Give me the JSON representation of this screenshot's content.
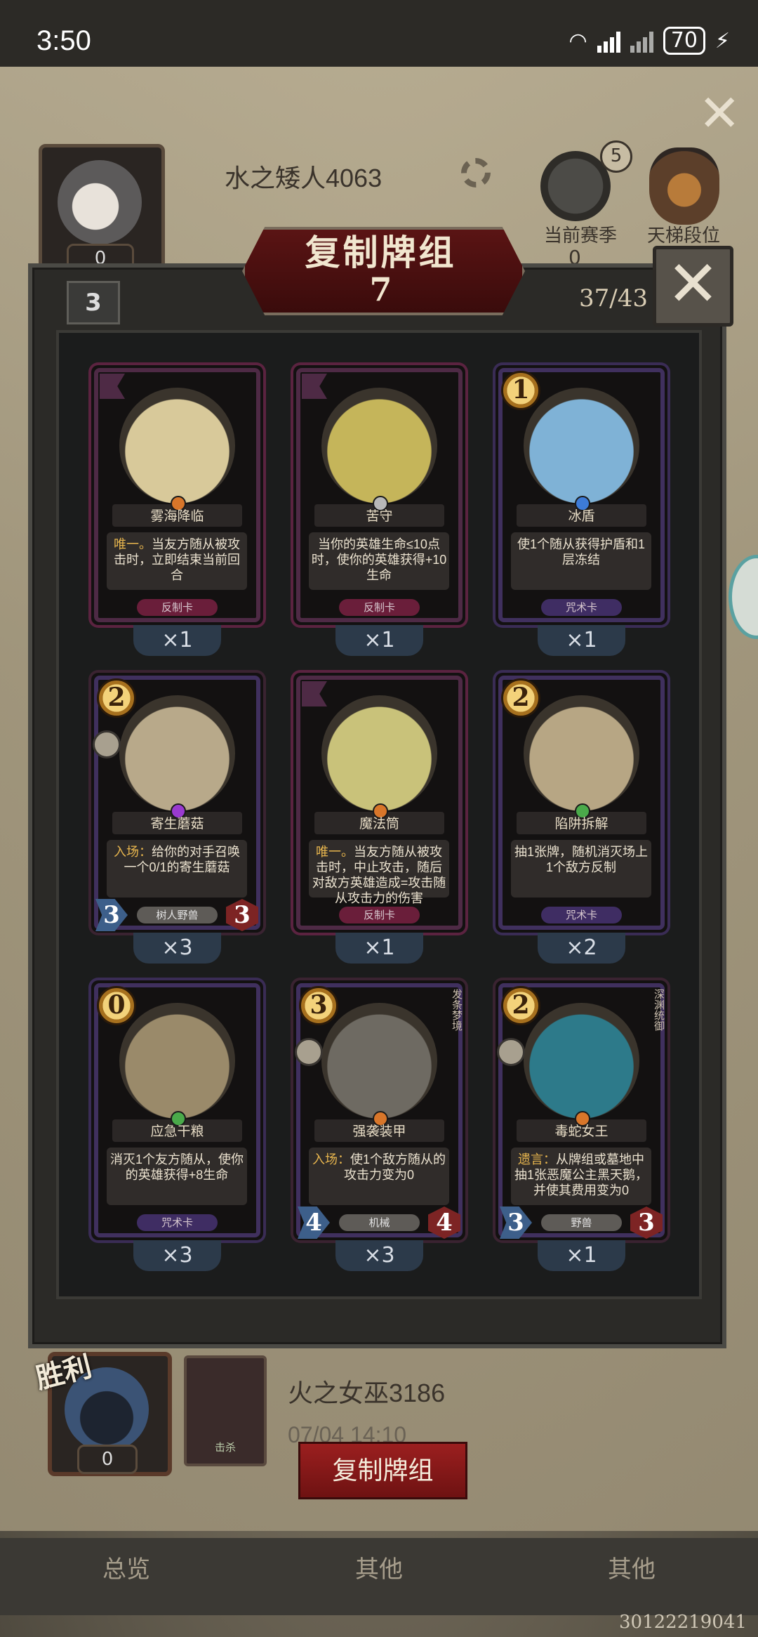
{
  "status_bar": {
    "time": "3:50",
    "battery": "70"
  },
  "header": {
    "close_icon": "close-icon",
    "player_name": "水之矮人4063",
    "avatar_level": "0",
    "season_badge": "5",
    "season_label": "当前赛季",
    "season_value": "0",
    "ladder_label": "天梯段位"
  },
  "modal": {
    "title": "复制牌组",
    "title_count": "7",
    "deck_tag": "3",
    "deck_count": "37/43"
  },
  "cards": [
    {
      "name": "雾海降临",
      "cost": "",
      "desc_kw": "唯一。",
      "desc": "当友方随从被攻击时，立即结束当前回合",
      "type": "反制卡",
      "qty": "×1",
      "rarity": "#d8762a"
    },
    {
      "name": "苦守",
      "cost": "",
      "desc_kw": "",
      "desc": "当你的英雄生命≤10点时，使你的英雄获得+10生命",
      "type": "反制卡",
      "qty": "×1",
      "rarity": "#b8b8b8"
    },
    {
      "name": "冰盾",
      "cost": "1",
      "desc_kw": "",
      "desc": "使1个随从获得护盾和1层冻结",
      "type": "咒术卡",
      "qty": "×1",
      "rarity": "#3d7bd8"
    },
    {
      "name": "寄生蘑菇",
      "cost": "2",
      "desc_kw": "入场：",
      "desc": "给你的对手召唤一个0/1的寄生蘑菇",
      "type": "树人野兽",
      "qty": "×3",
      "rarity": "#9a3ad0",
      "atk": "3",
      "hp": "3"
    },
    {
      "name": "魔法筒",
      "cost": "",
      "desc_kw": "唯一。",
      "desc": "当友方随从被攻击时，中止攻击，随后对敌方英雄造成=攻击随从攻击力的伤害",
      "type": "反制卡",
      "qty": "×1",
      "rarity": "#d8762a"
    },
    {
      "name": "陷阱拆解",
      "cost": "2",
      "desc_kw": "",
      "desc": "抽1张牌，随机消灭场上1个敌方反制",
      "type": "咒术卡",
      "qty": "×2",
      "rarity": "#4aaa4a"
    },
    {
      "name": "应急干粮",
      "cost": "0",
      "desc_kw": "",
      "desc": "消灭1个友方随从，使你的英雄获得+8生命",
      "type": "咒术卡",
      "qty": "×3",
      "rarity": "#4aaa4a"
    },
    {
      "name": "强袭装甲",
      "cost": "3",
      "desc_kw": "入场：",
      "desc": "使1个敌方随从的攻击力变为0",
      "type": "机械",
      "qty": "×3",
      "rarity": "#d8762a",
      "atk": "4",
      "hp": "4",
      "side": "发条梦境"
    },
    {
      "name": "毒蛇女王",
      "cost": "2",
      "desc_kw": "遗言：",
      "desc": "从牌组或墓地中抽1张恶魔公主黑天鹅，并使其费用变为0",
      "type": "野兽",
      "qty": "×1",
      "rarity": "#d8762a",
      "atk": "3",
      "hp": "3",
      "side": "深渊统御"
    }
  ],
  "bottom": {
    "win_label": "胜利",
    "win_level": "0",
    "mini_card_label": "击杀",
    "opponent_name": "火之女巫3186",
    "match_time": "07/04 14:10",
    "copy_button": "复制牌组",
    "nav": [
      "总览",
      "其他",
      "其他"
    ],
    "uid": "30122219041"
  }
}
